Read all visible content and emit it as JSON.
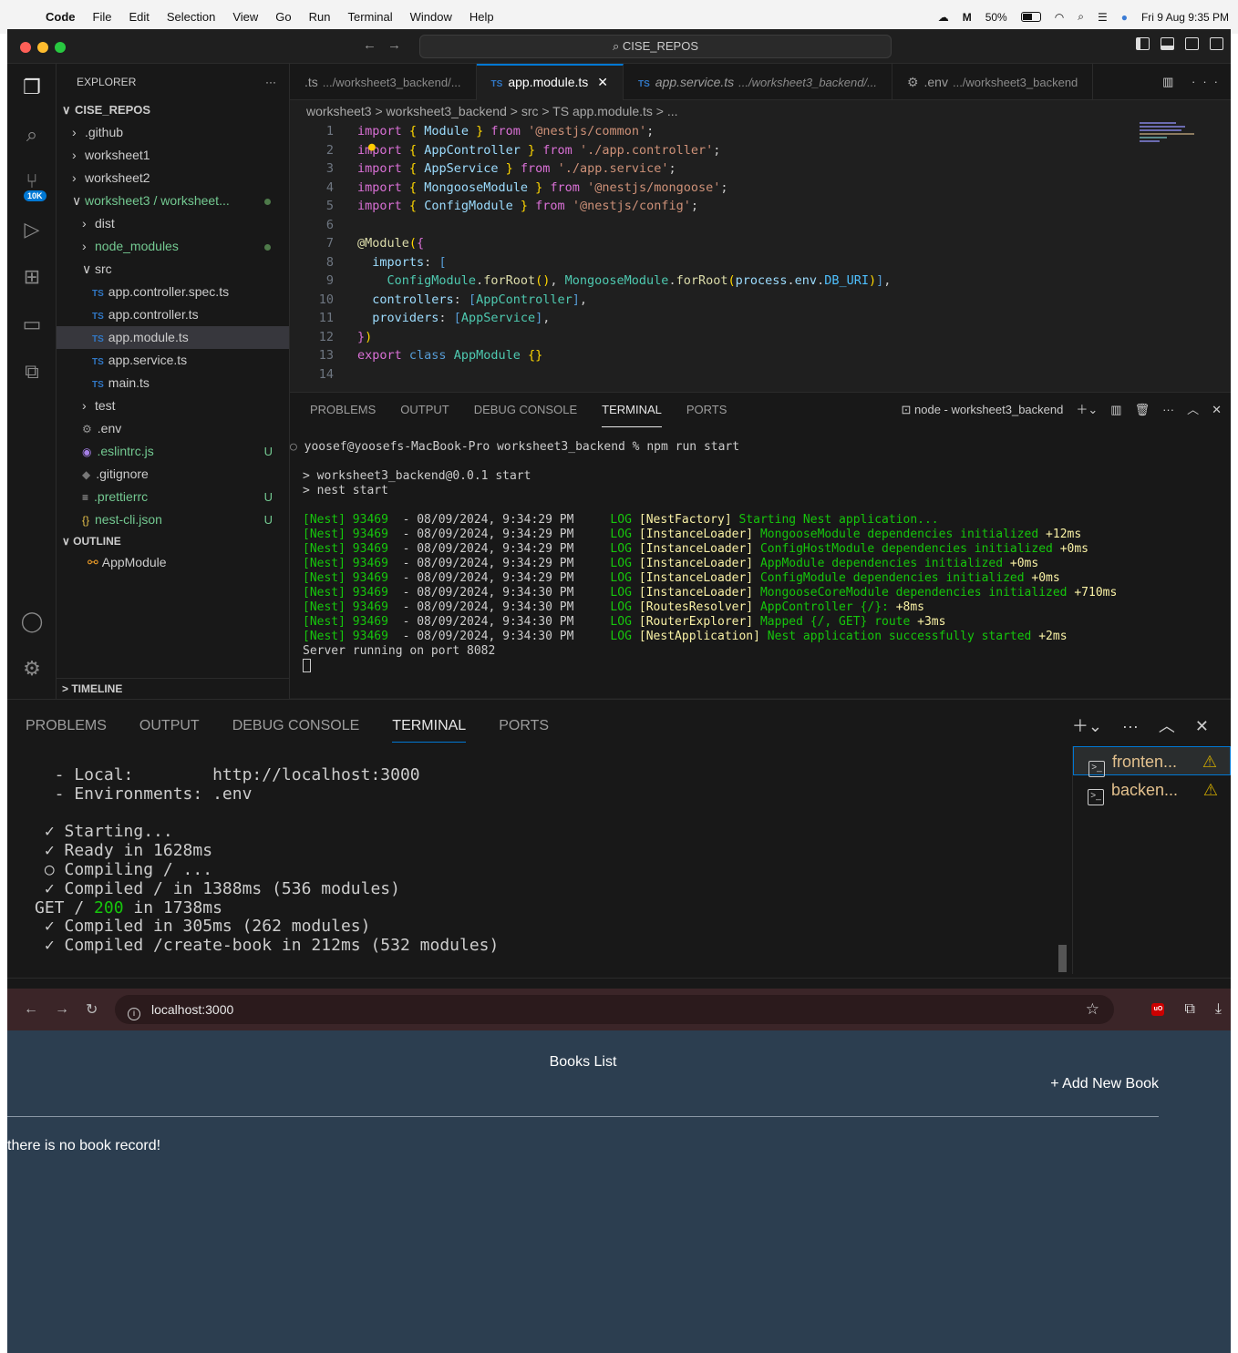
{
  "menubar": {
    "app": "Code",
    "items": [
      "File",
      "Edit",
      "Selection",
      "View",
      "Go",
      "Run",
      "Terminal",
      "Window",
      "Help"
    ],
    "battery": "50%",
    "datetime": "Fri 9 Aug  9:35 PM"
  },
  "window1": {
    "command_center": "CISE_REPOS",
    "activity_badge": "10K",
    "explorer": {
      "title": "EXPLORER",
      "root": "CISE_REPOS",
      "items": [
        {
          "label": ".github",
          "chev": ">",
          "indent": 1
        },
        {
          "label": "worksheet1",
          "chev": ">",
          "indent": 1
        },
        {
          "label": "worksheet2",
          "chev": ">",
          "indent": 1
        },
        {
          "label": "worksheet3 / worksheet...",
          "chev": "v",
          "indent": 1
        },
        {
          "label": "dist",
          "chev": ">",
          "indent": 2
        },
        {
          "label": "node_modules",
          "chev": ">",
          "indent": 2
        },
        {
          "label": "src",
          "chev": "v",
          "indent": 2
        },
        {
          "label": "app.controller.spec.ts",
          "indent": 3
        },
        {
          "label": "app.controller.ts",
          "indent": 3
        },
        {
          "label": "app.module.ts",
          "indent": 3
        },
        {
          "label": "app.service.ts",
          "indent": 3
        },
        {
          "label": "main.ts",
          "indent": 3
        },
        {
          "label": "test",
          "chev": ">",
          "indent": 2
        },
        {
          "label": ".env",
          "indent": 2
        },
        {
          "label": ".eslintrc.js",
          "indent": 2
        },
        {
          "label": ".gitignore",
          "indent": 2
        },
        {
          "label": ".prettierrc",
          "indent": 2
        },
        {
          "label": "nest-cli.json",
          "indent": 2
        }
      ],
      "u_marker": "U",
      "outline_title": "OUTLINE",
      "outline_item": "AppModule",
      "timeline_title": "TIMELINE"
    },
    "tabs": [
      {
        "label": ".ts",
        "path": ".../worksheet3_backend/..."
      },
      {
        "label": "app.module.ts",
        "path": ""
      },
      {
        "label": "app.service.ts",
        "path": ".../worksheet3_backend/..."
      },
      {
        "label": ".env",
        "path": ".../worksheet3_backend"
      }
    ],
    "ts_badge": "TS",
    "breadcrumbs": "worksheet3 > worksheet3_backend > src > TS app.module.ts > ...",
    "code_lines": [
      "1",
      "2",
      "3",
      "4",
      "5",
      "6",
      "7",
      "8",
      "9",
      "10",
      "11",
      "12",
      "13",
      "14"
    ],
    "panel": {
      "tabs": [
        "PROBLEMS",
        "OUTPUT",
        "DEBUG CONSOLE",
        "TERMINAL",
        "PORTS"
      ],
      "terminal_name": "node - worksheet3_backend",
      "prompt": "yoosef@yoosefs-MacBook-Pro worksheet3_backend % npm run start",
      "start_lines": [
        "> worksheet3_backend@0.0.1 start",
        "> nest start"
      ],
      "logs": [
        {
          "pid": "[Nest] 93469",
          "time": "  - 08/09/2024, 9:34:29 PM",
          "ctx": "[NestFactory]",
          "msg": " Starting Nest application...",
          "dt": ""
        },
        {
          "pid": "[Nest] 93469",
          "time": "  - 08/09/2024, 9:34:29 PM",
          "ctx": "[InstanceLoader]",
          "msg": " MongooseModule dependencies initialized ",
          "dt": "+12ms"
        },
        {
          "pid": "[Nest] 93469",
          "time": "  - 08/09/2024, 9:34:29 PM",
          "ctx": "[InstanceLoader]",
          "msg": " ConfigHostModule dependencies initialized ",
          "dt": "+0ms"
        },
        {
          "pid": "[Nest] 93469",
          "time": "  - 08/09/2024, 9:34:29 PM",
          "ctx": "[InstanceLoader]",
          "msg": " AppModule dependencies initialized ",
          "dt": "+0ms"
        },
        {
          "pid": "[Nest] 93469",
          "time": "  - 08/09/2024, 9:34:29 PM",
          "ctx": "[InstanceLoader]",
          "msg": " ConfigModule dependencies initialized ",
          "dt": "+0ms"
        },
        {
          "pid": "[Nest] 93469",
          "time": "  - 08/09/2024, 9:34:30 PM",
          "ctx": "[InstanceLoader]",
          "msg": " MongooseCoreModule dependencies initialized ",
          "dt": "+710ms"
        },
        {
          "pid": "[Nest] 93469",
          "time": "  - 08/09/2024, 9:34:30 PM",
          "ctx": "[RoutesResolver]",
          "msg": " AppController {/}: ",
          "dt": "+8ms"
        },
        {
          "pid": "[Nest] 93469",
          "time": "  - 08/09/2024, 9:34:30 PM",
          "ctx": "[RouterExplorer]",
          "msg": " Mapped {/, GET} route ",
          "dt": "+3ms"
        },
        {
          "pid": "[Nest] 93469",
          "time": "  - 08/09/2024, 9:34:30 PM",
          "ctx": "[NestApplication]",
          "msg": " Nest application successfully started ",
          "dt": "+2ms"
        }
      ],
      "log_label": "LOG",
      "server_line": "Server running on port 8082"
    }
  },
  "window2": {
    "tabs": [
      "PROBLEMS",
      "OUTPUT",
      "DEBUG CONSOLE",
      "TERMINAL",
      "PORTS"
    ],
    "lines": [
      {
        "pre": "  - Local:        http://localhost:3000",
        "hl": "",
        "post": ""
      },
      {
        "pre": "  - Environments: .env",
        "hl": "",
        "post": ""
      },
      {
        "pre": "",
        "hl": "",
        "post": ""
      },
      {
        "pre": " ✓ Starting...",
        "hl": "",
        "post": ""
      },
      {
        "pre": " ✓ Ready in 1628ms",
        "hl": "",
        "post": ""
      },
      {
        "pre": " ○ Compiling / ...",
        "hl": "",
        "post": ""
      },
      {
        "pre": " ✓ Compiled / in 1388ms (536 modules)",
        "hl": "",
        "post": ""
      },
      {
        "pre": "GET / ",
        "hl": "200",
        "post": " in 1738ms"
      },
      {
        "pre": " ✓ Compiled in 305ms (262 modules)",
        "hl": "",
        "post": ""
      },
      {
        "pre": " ✓ Compiled /create-book in 212ms (532 modules)",
        "hl": "",
        "post": ""
      }
    ],
    "terminals": [
      "fronten...",
      "backen..."
    ]
  },
  "browser": {
    "url": "localhost:3000",
    "page_title": "Books List",
    "add_link": "+ Add New Book",
    "empty_message": "there is no book record!"
  }
}
